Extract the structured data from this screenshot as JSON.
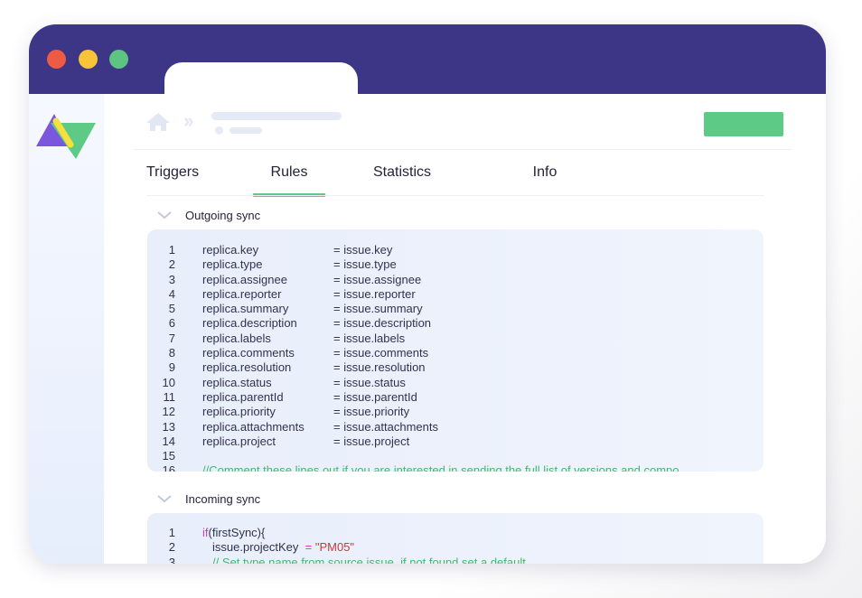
{
  "window": {
    "tabs": [
      "Triggers",
      "Rules",
      "Statistics",
      "Info"
    ],
    "active_tab": "Rules",
    "colors": {
      "titlebar": "#3d3585",
      "accent": "#5dcb86",
      "close": "#ee5b45",
      "minimize": "#f7c338",
      "maximize": "#5ec482"
    }
  },
  "outgoing": {
    "title": "Outgoing sync",
    "lines": [
      {
        "n": "1",
        "left": "replica.key",
        "right": "= issue.key"
      },
      {
        "n": "2",
        "left": "replica.type",
        "right": "= issue.type"
      },
      {
        "n": "3",
        "left": "replica.assignee",
        "right": "= issue.assignee"
      },
      {
        "n": "4",
        "left": "replica.reporter",
        "right": "= issue.reporter"
      },
      {
        "n": "5",
        "left": "replica.summary",
        "right": "= issue.summary"
      },
      {
        "n": "6",
        "left": "replica.description",
        "right": "= issue.description"
      },
      {
        "n": "7",
        "left": "replica.labels",
        "right": "= issue.labels"
      },
      {
        "n": "8",
        "left": "replica.comments",
        "right": "= issue.comments"
      },
      {
        "n": "9",
        "left": "replica.resolution",
        "right": "= issue.resolution"
      },
      {
        "n": "10",
        "left": "replica.status",
        "right": "= issue.status"
      },
      {
        "n": "11",
        "left": "replica.parentId",
        "right": "= issue.parentId"
      },
      {
        "n": "12",
        "left": "replica.priority",
        "right": "= issue.priority"
      },
      {
        "n": "13",
        "left": "replica.attachments",
        "right": "= issue.attachments"
      },
      {
        "n": "14",
        "left": "replica.project",
        "right": "= issue.project"
      },
      {
        "n": "15",
        "left": "",
        "right": ""
      },
      {
        "n": "16",
        "comment": "//Comment these lines out if you are interested in sending the full list of versions and compo"
      }
    ]
  },
  "incoming": {
    "title": "Incoming sync",
    "line1": {
      "n": "1",
      "kw": "if",
      "rest": "(firstSync){"
    },
    "line2": {
      "n": "2",
      "left": "issue.projectKey",
      "op": "= ",
      "str": "\"PM05\""
    },
    "line3": {
      "n": "3",
      "comment": "// Set type name from source issue, if not found set a default"
    }
  }
}
